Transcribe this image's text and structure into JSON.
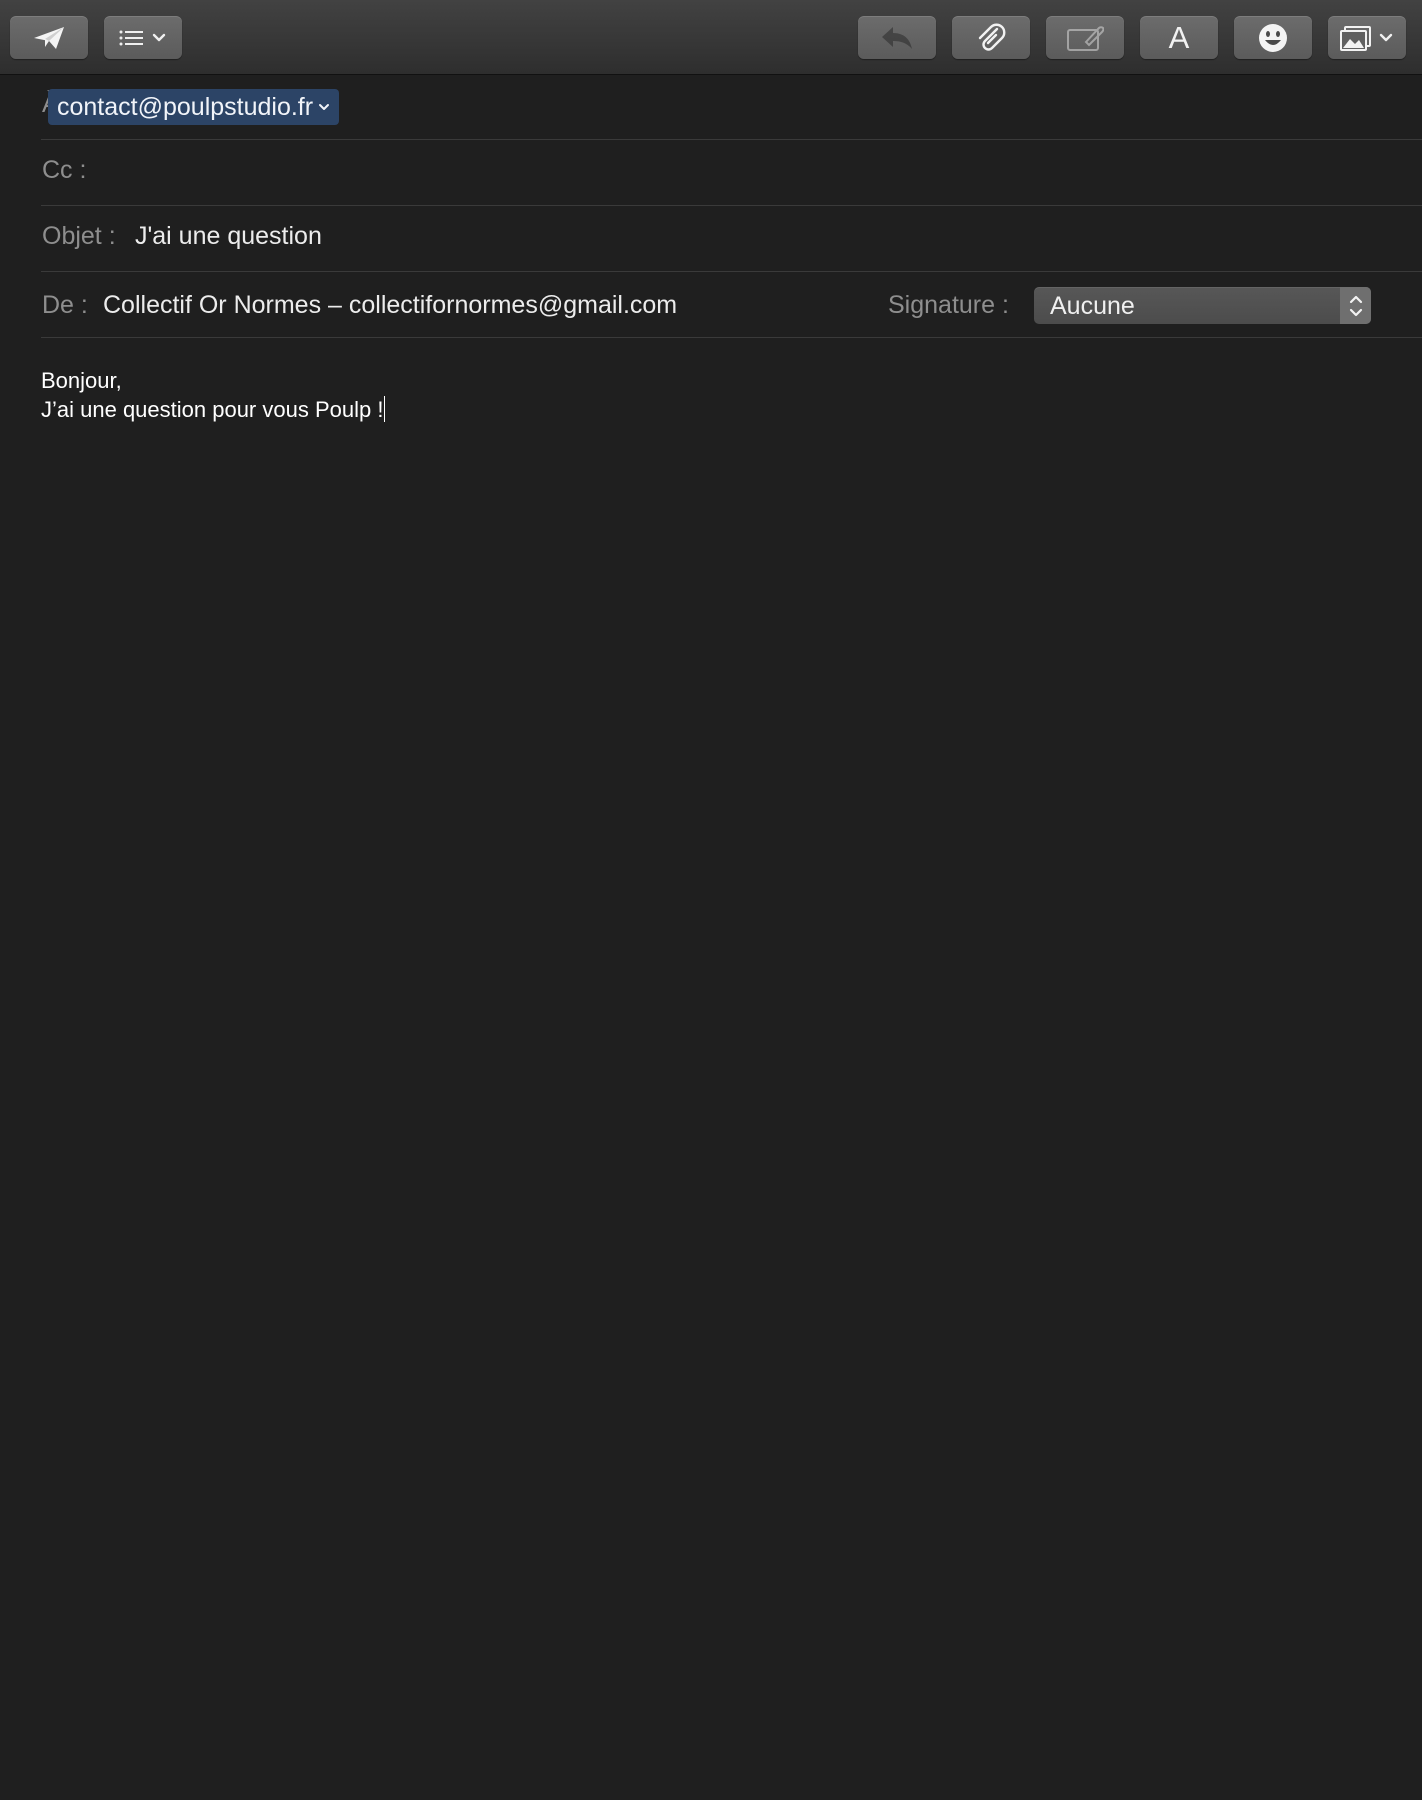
{
  "toolbar": {
    "buttons": [
      {
        "name": "send",
        "icon": "paper-plane-icon"
      },
      {
        "name": "header-fields",
        "icon": "list-icon"
      },
      {
        "name": "reply",
        "icon": "reply-arrow-icon"
      },
      {
        "name": "attach",
        "icon": "paperclip-icon"
      },
      {
        "name": "markup",
        "icon": "markup-icon"
      },
      {
        "name": "format",
        "icon": "font-icon",
        "label": "A"
      },
      {
        "name": "emoji",
        "icon": "smiley-icon"
      },
      {
        "name": "photo-browser",
        "icon": "photo-icon"
      }
    ]
  },
  "header": {
    "to_label": "À :",
    "to_recipient": "contact@poulpstudio.fr",
    "cc_label": "Cc :",
    "cc_value": "",
    "subject_label": "Objet :",
    "subject_value": "J'ai une question",
    "from_label": "De :",
    "from_value": "Collectif Or Normes – collectifornormes@gmail.com",
    "signature_label": "Signature :",
    "signature_value": "Aucune"
  },
  "body": {
    "lines": [
      "Bonjour,",
      "J’ai une question pour vous Poulp !"
    ]
  },
  "colors": {
    "background": "#1f1f1f",
    "toolbar": "#3a3a3a",
    "token": "#2c4466",
    "label": "#8e8e8e",
    "text": "#ececec"
  }
}
